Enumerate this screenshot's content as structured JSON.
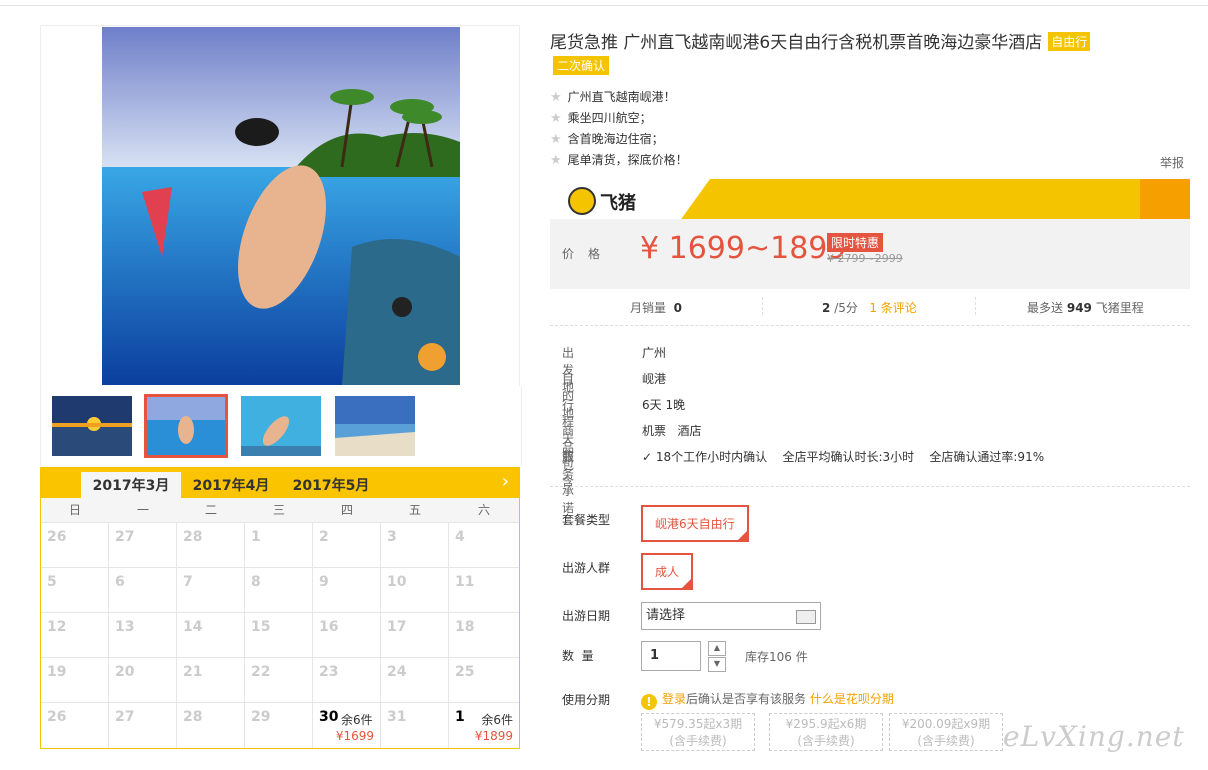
{
  "product": {
    "title": "尾货急推 广州直飞越南岘港6天自由行含税机票首晚海边豪华酒店",
    "type_tag": "自由行",
    "confirm_tag": "二次确认",
    "features": [
      "广州直飞越南岘港！",
      "乘坐四川航空；",
      "含首晚海边住宿；",
      "尾单清货，探底价格！"
    ],
    "report": "举报"
  },
  "brand": {
    "name": "飞猪",
    "logo_icon": "fliggy-pig-icon"
  },
  "price": {
    "label": "价格",
    "current": "¥ 1699~1899",
    "badge": "限时特惠",
    "original": "¥ 2799~2999"
  },
  "stats": {
    "monthly_label": "月销量",
    "monthly_value": "0",
    "rating_value": "2",
    "rating_suffix": "/5分",
    "reviews": "1 条评论",
    "miles_prefix": "最多送",
    "miles_value": "949",
    "miles_suffix": "飞猪里程"
  },
  "info": [
    {
      "key": "出 发 地",
      "value": "广州"
    },
    {
      "key": "目 的 地",
      "value": "岘港"
    },
    {
      "key": "行程天数",
      "value": "6天 1晚"
    },
    {
      "key": "商品包含",
      "value": "机票   酒店"
    }
  ],
  "service": {
    "key": "服务承诺",
    "promise": "18个工作小时内确认",
    "avg": "全店平均确认时长:3小时",
    "rate": "全店确认通过率:91%"
  },
  "options": {
    "package_label": "套餐类型",
    "package_value": "岘港6天自由行",
    "crowd_label": "出游人群",
    "crowd_value": "成人",
    "date_label": "出游日期",
    "date_placeholder": "请选择",
    "qty_label": "数  量",
    "qty_value": "1",
    "qty_up": "▲",
    "qty_down": "▼",
    "stock": "库存106 件",
    "installment_label": "使用分期",
    "installment_icon": "!",
    "installment_link": "登录",
    "installment_text": "后确认是否享有该服务",
    "installment_help": "什么是花呗分期",
    "installments": [
      {
        "line1": "¥579.35起x3期",
        "line2": "(含手续费)"
      },
      {
        "line1": "¥295.9起x6期",
        "line2": "(含手续费)"
      },
      {
        "line1": "¥200.09起x9期",
        "line2": "(含手续费)"
      }
    ]
  },
  "calendar": {
    "months": [
      "2017年3月",
      "2017年4月",
      "2017年5月"
    ],
    "active_month": 0,
    "next": "›",
    "weekdays": [
      "日",
      "一",
      "二",
      "三",
      "四",
      "五",
      "六"
    ],
    "rows": [
      [
        {
          "d": "26"
        },
        {
          "d": "27"
        },
        {
          "d": "28"
        },
        {
          "d": "1"
        },
        {
          "d": "2"
        },
        {
          "d": "3"
        },
        {
          "d": "4"
        }
      ],
      [
        {
          "d": "5"
        },
        {
          "d": "6"
        },
        {
          "d": "7"
        },
        {
          "d": "8"
        },
        {
          "d": "9"
        },
        {
          "d": "10"
        },
        {
          "d": "11"
        }
      ],
      [
        {
          "d": "12"
        },
        {
          "d": "13"
        },
        {
          "d": "14"
        },
        {
          "d": "15"
        },
        {
          "d": "16"
        },
        {
          "d": "17"
        },
        {
          "d": "18"
        }
      ],
      [
        {
          "d": "19"
        },
        {
          "d": "20"
        },
        {
          "d": "21"
        },
        {
          "d": "22"
        },
        {
          "d": "23"
        },
        {
          "d": "24"
        },
        {
          "d": "25"
        }
      ],
      [
        {
          "d": "26"
        },
        {
          "d": "27"
        },
        {
          "d": "28"
        },
        {
          "d": "29"
        },
        {
          "d": "30",
          "stock": "余6件",
          "price": "¥1699"
        },
        {
          "d": "31"
        },
        {
          "d": "1",
          "stock": "余6件",
          "price": "¥1899"
        }
      ]
    ]
  },
  "watermark": "eLvXing.net"
}
